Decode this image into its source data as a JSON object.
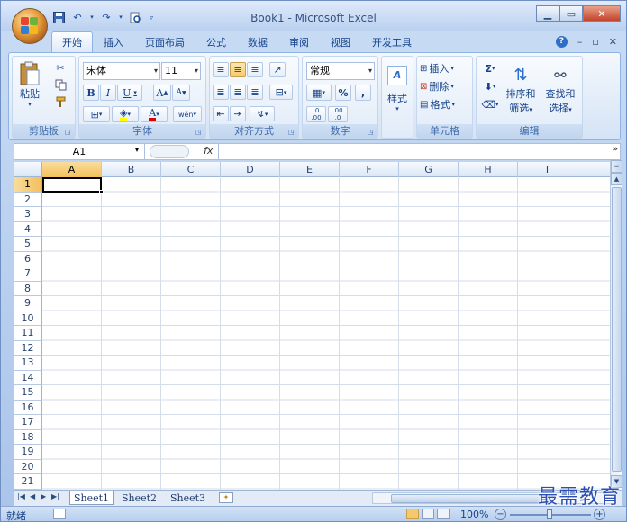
{
  "window": {
    "title": "Book1 - Microsoft Excel",
    "minimize_icon": "minimize-icon",
    "maximize_icon": "maximize-icon",
    "close_icon": "close-icon"
  },
  "ribbon_tabs": [
    "开始",
    "插入",
    "页面布局",
    "公式",
    "数据",
    "审阅",
    "视图",
    "开发工具"
  ],
  "active_tab": "开始",
  "clipboard": {
    "paste": "粘贴",
    "group": "剪贴板"
  },
  "font": {
    "name": "宋体",
    "size": "11",
    "group": "字体",
    "bold": "B",
    "italic": "I",
    "underline": "U",
    "grow": "A",
    "shrink": "A",
    "color_a": "A",
    "phonetic": "wén"
  },
  "alignment": {
    "group": "对齐方式"
  },
  "number": {
    "format": "常规",
    "percent": "%",
    "comma": ",",
    "inc_decimal": ".0\n.00",
    "dec_decimal": ".00\n.0",
    "group": "数字"
  },
  "styles": {
    "label": "样式"
  },
  "cells": {
    "insert": "插入",
    "delete": "删除",
    "format": "格式",
    "group": "单元格"
  },
  "editing": {
    "sum": "Σ",
    "sort_filter_1": "排序和",
    "sort_filter_2": "筛选",
    "find_1": "查找和",
    "find_2": "选择",
    "group": "编辑"
  },
  "formula_bar": {
    "name_box": "A1",
    "fx": "fx",
    "value": ""
  },
  "columns": [
    "A",
    "B",
    "C",
    "D",
    "E",
    "F",
    "G",
    "H",
    "I"
  ],
  "rows": [
    "1",
    "2",
    "3",
    "4",
    "5",
    "6",
    "7",
    "8",
    "9",
    "10",
    "11",
    "12",
    "13",
    "14",
    "15",
    "16",
    "17",
    "18",
    "19",
    "20",
    "21"
  ],
  "active_cell": "A1",
  "sheets": [
    "Sheet1",
    "Sheet2",
    "Sheet3"
  ],
  "active_sheet": "Sheet1",
  "status": {
    "text": "就绪",
    "zoom": "100%"
  },
  "watermark": "最需教育",
  "colors": {
    "ribbon_blue": "#15428b",
    "selected_header": "#f3bf5c",
    "grid_line": "#d4dde9"
  }
}
